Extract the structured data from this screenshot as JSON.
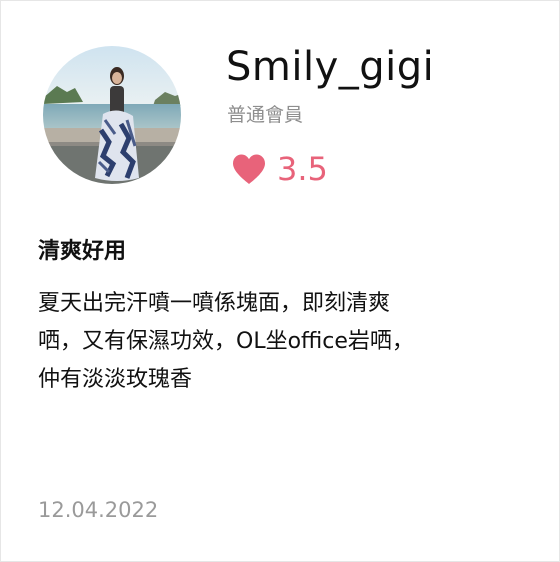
{
  "user": {
    "name": "Smily_gigi",
    "level": "普通會員",
    "avatar_icon": "user-avatar-photo"
  },
  "rating": {
    "icon": "heart-icon",
    "value": "3.5",
    "color": "#e8637a"
  },
  "review": {
    "title": "清爽好用",
    "lines": [
      "夏天出完汗噴一噴係塊面，即刻清爽",
      "哂，又有保濕功效，OL坐office岩哂，",
      "仲有淡淡玫瑰香"
    ],
    "date": "12.04.2022"
  }
}
